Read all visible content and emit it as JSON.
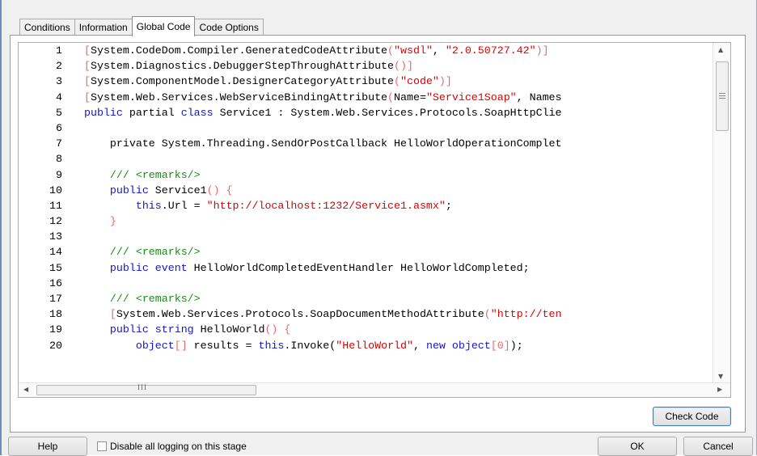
{
  "tabs": [
    {
      "label": "Conditions"
    },
    {
      "label": "Information"
    },
    {
      "label": "Global Code"
    },
    {
      "label": "Code Options"
    }
  ],
  "active_tab": "Global Code",
  "code_lines": [
    {
      "n": "1",
      "tokens": [
        [
          "br",
          "["
        ],
        [
          "t",
          "System.CodeDom.Compiler.GeneratedCodeAttribute"
        ],
        [
          "br",
          "("
        ],
        [
          "str",
          "\"wsdl\""
        ],
        [
          "t",
          ", "
        ],
        [
          "str",
          "\"2.0.50727.42\""
        ],
        [
          "br",
          ")]"
        ]
      ]
    },
    {
      "n": "2",
      "tokens": [
        [
          "br",
          "["
        ],
        [
          "t",
          "System.Diagnostics.DebuggerStepThroughAttribute"
        ],
        [
          "br",
          "()]"
        ]
      ]
    },
    {
      "n": "3",
      "tokens": [
        [
          "br",
          "["
        ],
        [
          "t",
          "System.ComponentModel.DesignerCategoryAttribute"
        ],
        [
          "br",
          "("
        ],
        [
          "str",
          "\"code\""
        ],
        [
          "br",
          ")]"
        ]
      ]
    },
    {
      "n": "4",
      "tokens": [
        [
          "br",
          "["
        ],
        [
          "t",
          "System.Web.Services.WebServiceBindingAttribute"
        ],
        [
          "br",
          "("
        ],
        [
          "t",
          "Name="
        ],
        [
          "str",
          "\"Service1Soap\""
        ],
        [
          "t",
          ", Names"
        ]
      ]
    },
    {
      "n": "5",
      "tokens": [
        [
          "kw",
          "public"
        ],
        [
          "t",
          " partial "
        ],
        [
          "kw",
          "class"
        ],
        [
          "t",
          " Service1 : System.Web.Services.Protocols.SoapHttpClie"
        ]
      ]
    },
    {
      "n": "6",
      "tokens": []
    },
    {
      "n": "7",
      "tokens": [
        [
          "t",
          "    private System.Threading.SendOrPostCallback HelloWorldOperationComplet"
        ]
      ]
    },
    {
      "n": "8",
      "tokens": []
    },
    {
      "n": "9",
      "tokens": [
        [
          "cm",
          "    /// <remarks/>"
        ]
      ]
    },
    {
      "n": "10",
      "tokens": [
        [
          "kw",
          "    public"
        ],
        [
          "t",
          " Service1"
        ],
        [
          "br",
          "() {"
        ]
      ]
    },
    {
      "n": "11",
      "tokens": [
        [
          "kw",
          "        this"
        ],
        [
          "t",
          ".Url = "
        ],
        [
          "str",
          "\"http://localhost:1232/Service1.asmx\""
        ],
        [
          "t",
          ";"
        ]
      ]
    },
    {
      "n": "12",
      "tokens": [
        [
          "br",
          "    }"
        ]
      ]
    },
    {
      "n": "13",
      "tokens": []
    },
    {
      "n": "14",
      "tokens": [
        [
          "cm",
          "    /// <remarks/>"
        ]
      ]
    },
    {
      "n": "15",
      "tokens": [
        [
          "kw",
          "    public event"
        ],
        [
          "t",
          " HelloWorldCompletedEventHandler HelloWorldCompleted;"
        ]
      ]
    },
    {
      "n": "16",
      "tokens": []
    },
    {
      "n": "17",
      "tokens": [
        [
          "cm",
          "    /// <remarks/>"
        ]
      ]
    },
    {
      "n": "18",
      "tokens": [
        [
          "br",
          "    ["
        ],
        [
          "t",
          "System.Web.Services.Protocols.SoapDocumentMethodAttribute"
        ],
        [
          "br",
          "("
        ],
        [
          "str",
          "\"http://ten"
        ]
      ]
    },
    {
      "n": "19",
      "tokens": [
        [
          "kw",
          "    public string"
        ],
        [
          "t",
          " HelloWorld"
        ],
        [
          "br",
          "() {"
        ]
      ]
    },
    {
      "n": "20",
      "tokens": [
        [
          "kw",
          "        object"
        ],
        [
          "br",
          "[]"
        ],
        [
          "t",
          " results = "
        ],
        [
          "kw",
          "this"
        ],
        [
          "t",
          ".Invoke("
        ],
        [
          "str",
          "\"HelloWorld\""
        ],
        [
          "t",
          ", "
        ],
        [
          "kw",
          "new object"
        ],
        [
          "br",
          "[0]"
        ],
        [
          "t",
          ");"
        ]
      ]
    }
  ],
  "hscroll_label": "III",
  "buttons": {
    "check_code": "Check Code",
    "help": "Help",
    "ok": "OK",
    "cancel": "Cancel"
  },
  "disable_logging_label": "Disable all logging on this stage",
  "disable_logging_checked": false,
  "icons": {
    "scroll_up": "triangle-up-icon",
    "scroll_down": "triangle-down-icon",
    "scroll_left": "triangle-left-icon",
    "scroll_right": "triangle-right-icon"
  },
  "colors": {
    "bracket": "#e46b6b",
    "string": "#e00000",
    "keyword": "#1414d8",
    "comment": "#149114"
  }
}
